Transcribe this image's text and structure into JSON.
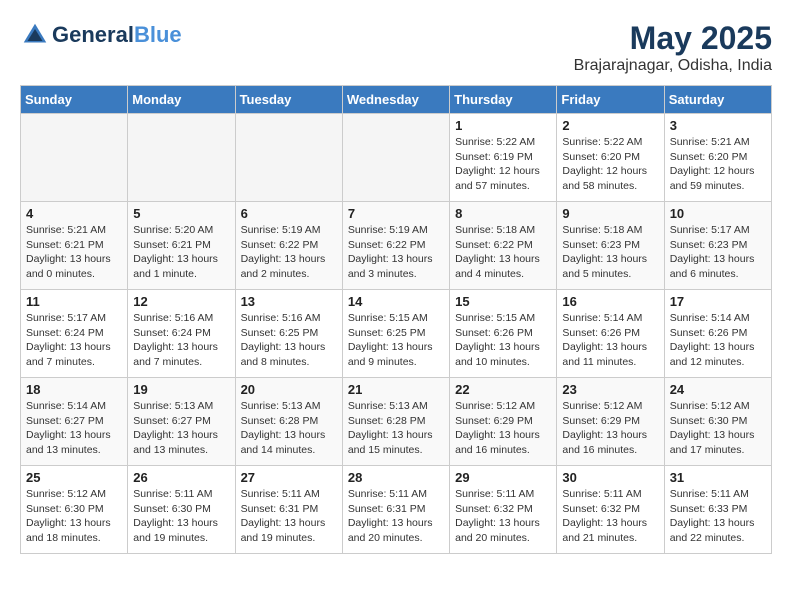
{
  "header": {
    "logo_line1": "General",
    "logo_line2": "Blue",
    "month": "May 2025",
    "location": "Brajarajnagar, Odisha, India"
  },
  "days_of_week": [
    "Sunday",
    "Monday",
    "Tuesday",
    "Wednesday",
    "Thursday",
    "Friday",
    "Saturday"
  ],
  "weeks": [
    [
      {
        "day": "",
        "info": ""
      },
      {
        "day": "",
        "info": ""
      },
      {
        "day": "",
        "info": ""
      },
      {
        "day": "",
        "info": ""
      },
      {
        "day": "1",
        "info": "Sunrise: 5:22 AM\nSunset: 6:19 PM\nDaylight: 12 hours\nand 57 minutes."
      },
      {
        "day": "2",
        "info": "Sunrise: 5:22 AM\nSunset: 6:20 PM\nDaylight: 12 hours\nand 58 minutes."
      },
      {
        "day": "3",
        "info": "Sunrise: 5:21 AM\nSunset: 6:20 PM\nDaylight: 12 hours\nand 59 minutes."
      }
    ],
    [
      {
        "day": "4",
        "info": "Sunrise: 5:21 AM\nSunset: 6:21 PM\nDaylight: 13 hours\nand 0 minutes."
      },
      {
        "day": "5",
        "info": "Sunrise: 5:20 AM\nSunset: 6:21 PM\nDaylight: 13 hours\nand 1 minute."
      },
      {
        "day": "6",
        "info": "Sunrise: 5:19 AM\nSunset: 6:22 PM\nDaylight: 13 hours\nand 2 minutes."
      },
      {
        "day": "7",
        "info": "Sunrise: 5:19 AM\nSunset: 6:22 PM\nDaylight: 13 hours\nand 3 minutes."
      },
      {
        "day": "8",
        "info": "Sunrise: 5:18 AM\nSunset: 6:22 PM\nDaylight: 13 hours\nand 4 minutes."
      },
      {
        "day": "9",
        "info": "Sunrise: 5:18 AM\nSunset: 6:23 PM\nDaylight: 13 hours\nand 5 minutes."
      },
      {
        "day": "10",
        "info": "Sunrise: 5:17 AM\nSunset: 6:23 PM\nDaylight: 13 hours\nand 6 minutes."
      }
    ],
    [
      {
        "day": "11",
        "info": "Sunrise: 5:17 AM\nSunset: 6:24 PM\nDaylight: 13 hours\nand 7 minutes."
      },
      {
        "day": "12",
        "info": "Sunrise: 5:16 AM\nSunset: 6:24 PM\nDaylight: 13 hours\nand 7 minutes."
      },
      {
        "day": "13",
        "info": "Sunrise: 5:16 AM\nSunset: 6:25 PM\nDaylight: 13 hours\nand 8 minutes."
      },
      {
        "day": "14",
        "info": "Sunrise: 5:15 AM\nSunset: 6:25 PM\nDaylight: 13 hours\nand 9 minutes."
      },
      {
        "day": "15",
        "info": "Sunrise: 5:15 AM\nSunset: 6:26 PM\nDaylight: 13 hours\nand 10 minutes."
      },
      {
        "day": "16",
        "info": "Sunrise: 5:14 AM\nSunset: 6:26 PM\nDaylight: 13 hours\nand 11 minutes."
      },
      {
        "day": "17",
        "info": "Sunrise: 5:14 AM\nSunset: 6:26 PM\nDaylight: 13 hours\nand 12 minutes."
      }
    ],
    [
      {
        "day": "18",
        "info": "Sunrise: 5:14 AM\nSunset: 6:27 PM\nDaylight: 13 hours\nand 13 minutes."
      },
      {
        "day": "19",
        "info": "Sunrise: 5:13 AM\nSunset: 6:27 PM\nDaylight: 13 hours\nand 13 minutes."
      },
      {
        "day": "20",
        "info": "Sunrise: 5:13 AM\nSunset: 6:28 PM\nDaylight: 13 hours\nand 14 minutes."
      },
      {
        "day": "21",
        "info": "Sunrise: 5:13 AM\nSunset: 6:28 PM\nDaylight: 13 hours\nand 15 minutes."
      },
      {
        "day": "22",
        "info": "Sunrise: 5:12 AM\nSunset: 6:29 PM\nDaylight: 13 hours\nand 16 minutes."
      },
      {
        "day": "23",
        "info": "Sunrise: 5:12 AM\nSunset: 6:29 PM\nDaylight: 13 hours\nand 16 minutes."
      },
      {
        "day": "24",
        "info": "Sunrise: 5:12 AM\nSunset: 6:30 PM\nDaylight: 13 hours\nand 17 minutes."
      }
    ],
    [
      {
        "day": "25",
        "info": "Sunrise: 5:12 AM\nSunset: 6:30 PM\nDaylight: 13 hours\nand 18 minutes."
      },
      {
        "day": "26",
        "info": "Sunrise: 5:11 AM\nSunset: 6:30 PM\nDaylight: 13 hours\nand 19 minutes."
      },
      {
        "day": "27",
        "info": "Sunrise: 5:11 AM\nSunset: 6:31 PM\nDaylight: 13 hours\nand 19 minutes."
      },
      {
        "day": "28",
        "info": "Sunrise: 5:11 AM\nSunset: 6:31 PM\nDaylight: 13 hours\nand 20 minutes."
      },
      {
        "day": "29",
        "info": "Sunrise: 5:11 AM\nSunset: 6:32 PM\nDaylight: 13 hours\nand 20 minutes."
      },
      {
        "day": "30",
        "info": "Sunrise: 5:11 AM\nSunset: 6:32 PM\nDaylight: 13 hours\nand 21 minutes."
      },
      {
        "day": "31",
        "info": "Sunrise: 5:11 AM\nSunset: 6:33 PM\nDaylight: 13 hours\nand 22 minutes."
      }
    ]
  ]
}
